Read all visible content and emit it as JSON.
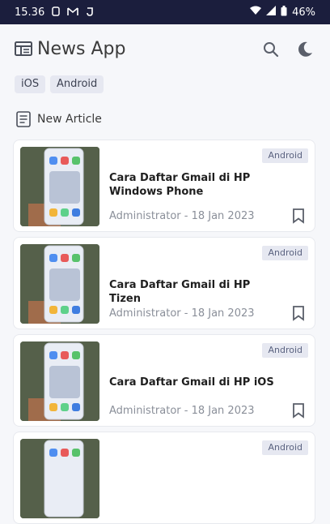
{
  "status_bar": {
    "time": "15.36",
    "battery": "46%"
  },
  "app_bar": {
    "title": "News App",
    "icons": [
      "news-icon",
      "search-icon",
      "moon-icon"
    ]
  },
  "categories": [
    {
      "label": "iOS"
    },
    {
      "label": "Android"
    }
  ],
  "section": {
    "title": "New Article",
    "icon": "article-icon"
  },
  "articles": [
    {
      "category": "Android",
      "title": "Cara Daftar Gmail di HP Windows Phone",
      "meta": "Administrator - 18 Jan 2023"
    },
    {
      "category": "Android",
      "title": "Cara Daftar Gmail di HP Tizen",
      "meta": "Administrator - 18 Jan 2023"
    },
    {
      "category": "Android",
      "title": "Cara Daftar Gmail di HP iOS",
      "meta": "Administrator - 18 Jan 2023"
    },
    {
      "category": "Android",
      "title": "",
      "meta": ""
    }
  ],
  "colors": {
    "status_bar_bg": "#1b1e3d",
    "chip_bg": "#e6e8f1",
    "page_bg": "#f6f7fa",
    "card_bg": "#ffffff"
  }
}
